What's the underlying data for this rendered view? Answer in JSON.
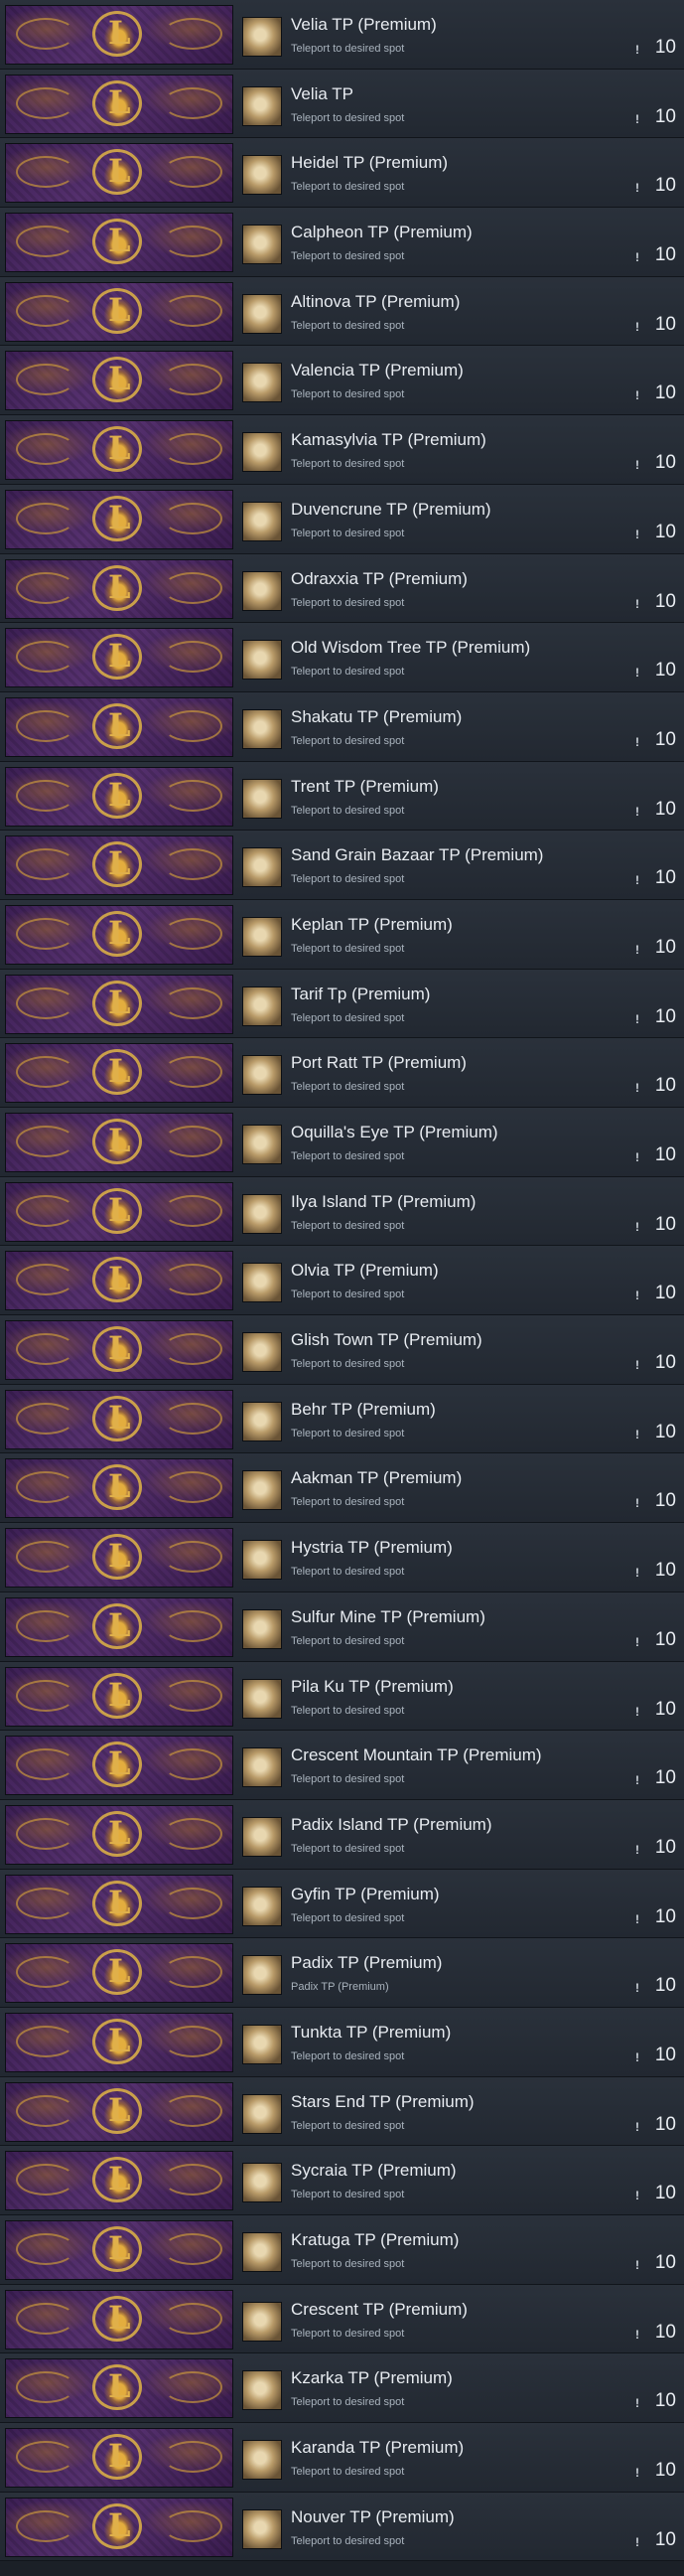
{
  "rows": [
    {
      "name": "Velia TP (Premium)",
      "desc": "Teleport to desired spot",
      "qty": "10"
    },
    {
      "name": "Velia TP",
      "desc": "Teleport to desired spot",
      "qty": "10"
    },
    {
      "name": "Heidel TP (Premium)",
      "desc": "Teleport to desired spot",
      "qty": "10"
    },
    {
      "name": "Calpheon TP (Premium)",
      "desc": "Teleport to desired spot",
      "qty": "10"
    },
    {
      "name": "Altinova TP (Premium)",
      "desc": "Teleport to desired spot",
      "qty": "10"
    },
    {
      "name": "Valencia TP (Premium)",
      "desc": "Teleport to desired spot",
      "qty": "10"
    },
    {
      "name": "Kamasylvia TP (Premium)",
      "desc": "Teleport to desired spot",
      "qty": "10"
    },
    {
      "name": "Duvencrune TP (Premium)",
      "desc": "Teleport to desired spot",
      "qty": "10"
    },
    {
      "name": "Odraxxia TP (Premium)",
      "desc": "Teleport to desired spot",
      "qty": "10"
    },
    {
      "name": "Old Wisdom Tree TP (Premium)",
      "desc": "Teleport to desired spot",
      "qty": "10"
    },
    {
      "name": "Shakatu TP (Premium)",
      "desc": "Teleport to desired spot",
      "qty": "10"
    },
    {
      "name": "Trent TP (Premium)",
      "desc": "Teleport to desired spot",
      "qty": "10"
    },
    {
      "name": "Sand Grain Bazaar TP (Premium)",
      "desc": "Teleport to desired spot",
      "qty": "10"
    },
    {
      "name": "Keplan TP (Premium)",
      "desc": "Teleport to desired spot",
      "qty": "10"
    },
    {
      "name": "Tarif Tp (Premium)",
      "desc": "Teleport to desired spot",
      "qty": "10"
    },
    {
      "name": "Port Ratt TP (Premium)",
      "desc": "Teleport to desired spot",
      "qty": "10"
    },
    {
      "name": "Oquilla's Eye TP (Premium)",
      "desc": "Teleport to desired spot",
      "qty": "10"
    },
    {
      "name": "Ilya Island TP (Premium)",
      "desc": "Teleport to desired spot",
      "qty": "10"
    },
    {
      "name": "Olvia TP (Premium)",
      "desc": "Teleport to desired spot",
      "qty": "10"
    },
    {
      "name": "Glish Town TP (Premium)",
      "desc": "Teleport to desired spot",
      "qty": "10"
    },
    {
      "name": "Behr TP (Premium)",
      "desc": "Teleport to desired spot",
      "qty": "10"
    },
    {
      "name": "Aakman TP (Premium)",
      "desc": "Teleport to desired spot",
      "qty": "10"
    },
    {
      "name": "Hystria TP (Premium)",
      "desc": "Teleport to desired spot",
      "qty": "10"
    },
    {
      "name": "Sulfur Mine TP (Premium)",
      "desc": "Teleport to desired spot",
      "qty": "10"
    },
    {
      "name": "Pila Ku TP (Premium)",
      "desc": "Teleport to desired spot",
      "qty": "10"
    },
    {
      "name": "Crescent Mountain TP (Premium)",
      "desc": "Teleport to desired spot",
      "qty": "10"
    },
    {
      "name": "Padix Island TP (Premium)",
      "desc": "Teleport to desired spot",
      "qty": "10"
    },
    {
      "name": "Gyfin TP (Premium)",
      "desc": "Teleport to desired spot",
      "qty": "10"
    },
    {
      "name": "Padix TP (Premium)",
      "desc": "Padix TP (Premium)",
      "qty": "10"
    },
    {
      "name": "Tunkta TP (Premium)",
      "desc": "Teleport to desired spot",
      "qty": "10"
    },
    {
      "name": "Stars End TP (Premium)",
      "desc": "Teleport to desired spot",
      "qty": "10"
    },
    {
      "name": "Sycraia TP (Premium)",
      "desc": "Teleport to desired spot",
      "qty": "10"
    },
    {
      "name": "Kratuga TP (Premium)",
      "desc": "Teleport to desired spot",
      "qty": "10"
    },
    {
      "name": "Crescent TP (Premium)",
      "desc": "Teleport to desired spot",
      "qty": "10"
    },
    {
      "name": "Kzarka TP (Premium)",
      "desc": "Teleport to desired spot",
      "qty": "10"
    },
    {
      "name": "Karanda TP (Premium)",
      "desc": "Teleport to desired spot",
      "qty": "10"
    },
    {
      "name": "Nouver TP (Premium)",
      "desc": "Teleport to desired spot",
      "qty": "10"
    }
  ],
  "icons": {
    "banner": "guild-crest-banner",
    "item": "teleport-scroll-icon",
    "qty": "stack-count-icon"
  },
  "colors": {
    "row_bg": "#252b34",
    "banner_purple": "#4a2663",
    "banner_gold": "#caa04a",
    "text_primary": "#e8ecf1",
    "text_secondary": "#a9b3bd"
  }
}
